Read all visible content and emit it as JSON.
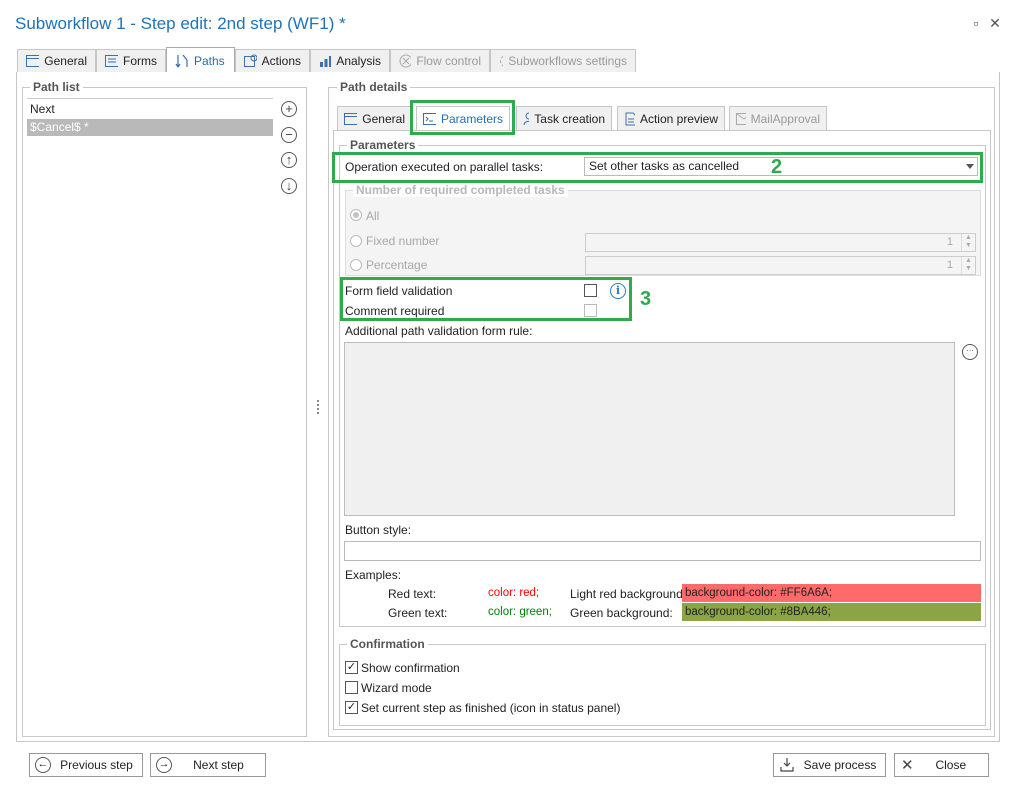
{
  "window": {
    "title": "Subworkflow 1 - Step edit: 2nd step (WF1) *",
    "restore_glyph": "▫",
    "close_glyph": "✕"
  },
  "main_tabs": [
    {
      "label": "General",
      "icon": "window-icon"
    },
    {
      "label": "Forms",
      "icon": "form-icon"
    },
    {
      "label": "Paths",
      "icon": "paths-icon"
    },
    {
      "label": "Actions",
      "icon": "actions-icon"
    },
    {
      "label": "Analysis",
      "icon": "analysis-icon"
    },
    {
      "label": "Flow control",
      "icon": "flow-control-icon"
    },
    {
      "label": "Subworkflows settings",
      "icon": "subworkflows-icon"
    }
  ],
  "path_list": {
    "title": "Path list",
    "items": [
      "Next",
      "$Cancel$ *"
    ],
    "add_glyph": "+",
    "remove_glyph": "−",
    "up_glyph": "↑",
    "down_glyph": "↓"
  },
  "path_details": {
    "title": "Path details",
    "tabs": [
      {
        "label": "General"
      },
      {
        "label": "Parameters"
      },
      {
        "label": "Task creation"
      },
      {
        "label": "Action preview"
      },
      {
        "label": "MailApproval"
      }
    ],
    "parameters": {
      "title": "Parameters",
      "operation_label": "Operation executed on parallel tasks:",
      "operation_value": "Set other tasks as cancelled",
      "required_group_title": "Number of required completed tasks",
      "radio_all": "All",
      "radio_fixed": "Fixed number",
      "radio_percentage": "Percentage",
      "fixed_value": "1",
      "percentage_value": "1",
      "form_field_validation": "Form field validation",
      "comment_required": "Comment required",
      "info_glyph": "i",
      "additional_rule_label": "Additional path validation form rule:",
      "more_glyph": "···",
      "button_style_label": "Button style:",
      "examples_label": "Examples:",
      "red_text_label": "Red text:",
      "red_text_code": "color: red;",
      "green_text_label": "Green text:",
      "green_text_code": "color: green;",
      "light_red_bg_label": "Light red background:",
      "light_red_bg_code": "background-color: #FF6A6A;",
      "green_bg_label": "Green background:",
      "green_bg_code": "background-color: #8BA446;"
    },
    "confirmation": {
      "title": "Confirmation",
      "show_confirmation": "Show confirmation",
      "wizard_mode": "Wizard mode",
      "set_current_step": "Set current step as finished (icon in status panel)",
      "check_glyph": "✓"
    }
  },
  "annotations": {
    "n2": "2",
    "n3": "3"
  },
  "footer": {
    "previous": "Previous step",
    "next": "Next step",
    "save": "Save process",
    "close": "Close",
    "prev_glyph": "←",
    "next_glyph": "→",
    "close_glyph": "✕"
  },
  "colors": {
    "accent": "#1e73b8",
    "annotation_green": "#2eab4c",
    "light_red": "#FF6A6A",
    "green_bg": "#8BA446"
  }
}
